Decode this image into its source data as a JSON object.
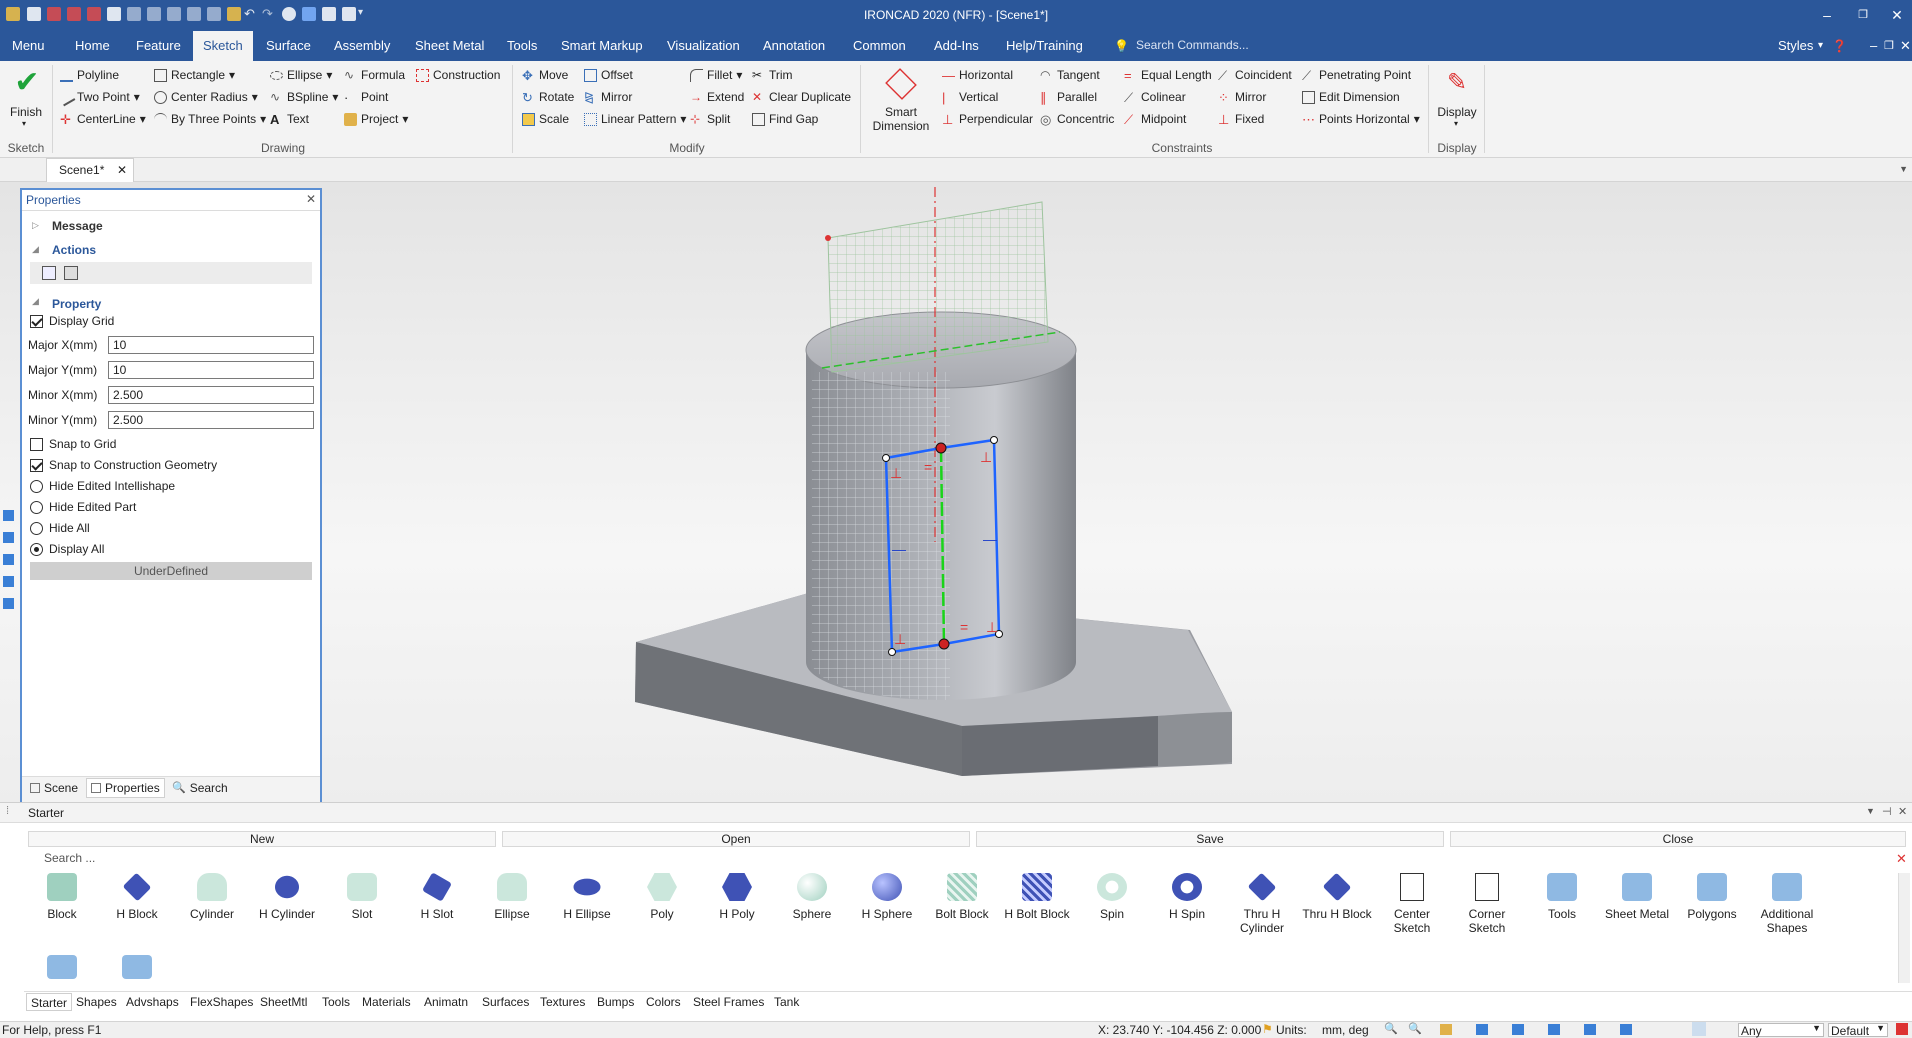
{
  "title": "IRONCAD 2020 (NFR) - [Scene1*]",
  "menu": [
    "Menu",
    "Home",
    "Feature",
    "Sketch",
    "Surface",
    "Assembly",
    "Sheet Metal",
    "Tools",
    "Smart Markup",
    "Visualization",
    "Annotation",
    "Common",
    "Add-Ins",
    "Help/Training"
  ],
  "search_placeholder": "Search Commands...",
  "styles_label": "Styles",
  "ribbon": {
    "finish": "Finish",
    "sketch_group": "Sketch",
    "drawing": [
      "Polyline",
      "Two Point",
      "CenterLine",
      "Rectangle",
      "Center Radius",
      "By Three Points",
      "Ellipse",
      "BSpline",
      "Text",
      "Formula",
      "Point",
      "Project",
      "Construction"
    ],
    "drawing_group": "Drawing",
    "modify": [
      "Move",
      "Rotate",
      "Scale",
      "Offset",
      "Mirror",
      "Linear Pattern",
      "Fillet",
      "Extend",
      "Split",
      "Trim",
      "Clear Duplicate",
      "Find Gap"
    ],
    "modify_group": "Modify",
    "smart_dim": "Smart Dimension",
    "constraints": [
      "Horizontal",
      "Vertical",
      "Perpendicular",
      "Tangent",
      "Parallel",
      "Concentric",
      "Equal Length",
      "Colinear",
      "Midpoint",
      "Coincident",
      "Mirror",
      "Fixed",
      "Penetrating Point",
      "Edit Dimension",
      "Points Horizontal"
    ],
    "constraints_group": "Constraints",
    "display": "Display",
    "display_group": "Display"
  },
  "doc_tab": "Scene1*",
  "properties": {
    "title": "Properties",
    "message": "Message",
    "actions": "Actions",
    "property": "Property",
    "display_grid": "Display Grid",
    "major_x_label": "Major X(mm)",
    "major_x": "10",
    "major_y_label": "Major Y(mm)",
    "major_y": "10",
    "minor_x_label": "Minor X(mm)",
    "minor_x": "2.500",
    "minor_y_label": "Minor Y(mm)",
    "minor_y": "2.500",
    "snap_grid": "Snap to Grid",
    "snap_cons": "Snap to Construction Geometry",
    "hide_intelli": "Hide Edited Intellishape",
    "hide_part": "Hide Edited Part",
    "hide_all": "Hide All",
    "display_all": "Display All",
    "status": "UnderDefined",
    "tabs": [
      "Scene",
      "Properties",
      "Search"
    ]
  },
  "catalog": {
    "title": "Starter",
    "buttons": [
      "New",
      "Open",
      "Save",
      "Close"
    ],
    "search": "Search ...",
    "shapes": [
      "Block",
      "H Block",
      "Cylinder",
      "H Cylinder",
      "Slot",
      "H Slot",
      "Ellipse",
      "H Ellipse",
      "Poly",
      "H Poly",
      "Sphere",
      "H Sphere",
      "Bolt Block",
      "H Bolt Block",
      "Spin",
      "H Spin",
      "Thru H Cylinder",
      "Thru H Block",
      "Center Sketch",
      "Corner Sketch",
      "Tools",
      "Sheet Metal",
      "Polygons",
      "Additional Shapes"
    ],
    "tabs": [
      "Starter",
      "Shapes",
      "Advshaps",
      "FlexShapes",
      "SheetMtl",
      "Tools",
      "Materials",
      "Animatn",
      "Surfaces",
      "Textures",
      "Bumps",
      "Colors",
      "Steel Frames",
      "Tank"
    ]
  },
  "status": {
    "help": "For Help, press F1",
    "coords": "X: 23.740 Y: -104.456 Z: 0.000",
    "units_label": "Units:",
    "units": "mm, deg",
    "filter": "Any",
    "style": "Default"
  }
}
